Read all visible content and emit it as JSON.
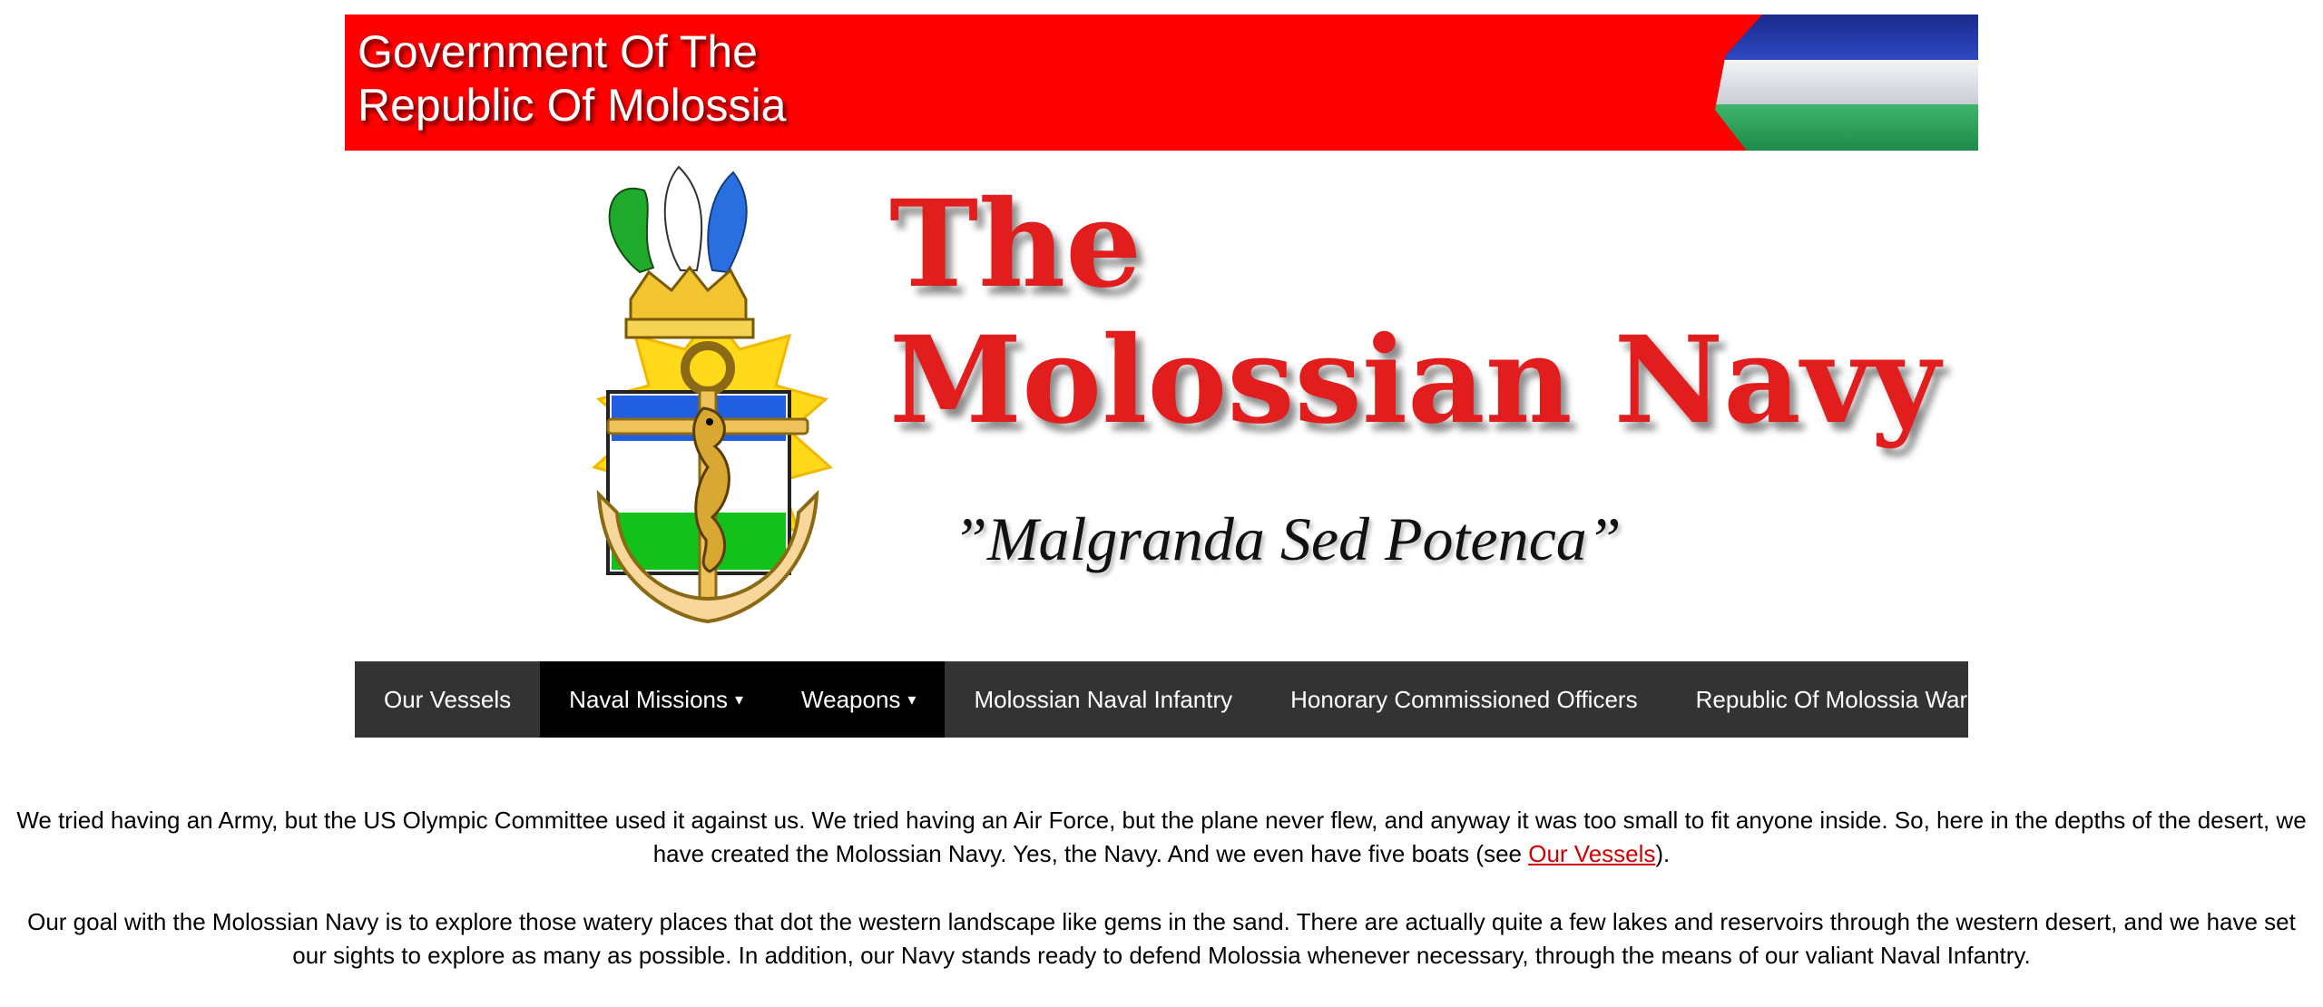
{
  "banner": {
    "line1": "Government Of The",
    "line2": "Republic Of Molossia",
    "flag_colors": [
      "#1a2a8c",
      "#f2f4f8",
      "#1e8a4a"
    ],
    "background": "#ff0000"
  },
  "masthead": {
    "title_line1": "The",
    "title_line2": "Molossian Navy",
    "motto": "”Malgranda Sed Potenca”",
    "emblem_icon": "navy-seahorse-anchor-crest",
    "title_color": "#e11d1d"
  },
  "nav": {
    "items": [
      {
        "label": "Our Vessels",
        "dropdown": false
      },
      {
        "label": "Naval Missions",
        "dropdown": true,
        "caret": "▾"
      },
      {
        "label": "Weapons",
        "dropdown": true,
        "caret": "▾"
      },
      {
        "label": "Molossian Naval Infantry",
        "dropdown": false
      },
      {
        "label": "Honorary Commissioned Officers",
        "dropdown": false
      },
      {
        "label": "Republic Of Molossia War Office",
        "dropdown": false
      }
    ]
  },
  "content": {
    "p1_text": "We tried having an Army, but the US Olympic Committee used it against us. We tried having an Air Force, but the plane never flew, and anyway it was too small to fit anyone inside. So, here in the depths of the desert, we have created the Molossian Navy. Yes, the Navy. And we even have five boats (see ",
    "p1_link": "Our Vessels",
    "p1_end": ").",
    "p2_text": "Our goal with the Molossian Navy is to explore those watery places that dot the western landscape like gems in the sand. There are actually quite a few lakes and reservoirs through the western desert, and we have set our sights to explore as many as possible. In addition, our Navy stands ready to defend Molossia whenever necessary, through the means of our valiant Naval Infantry.",
    "link_color": "#d10000"
  }
}
